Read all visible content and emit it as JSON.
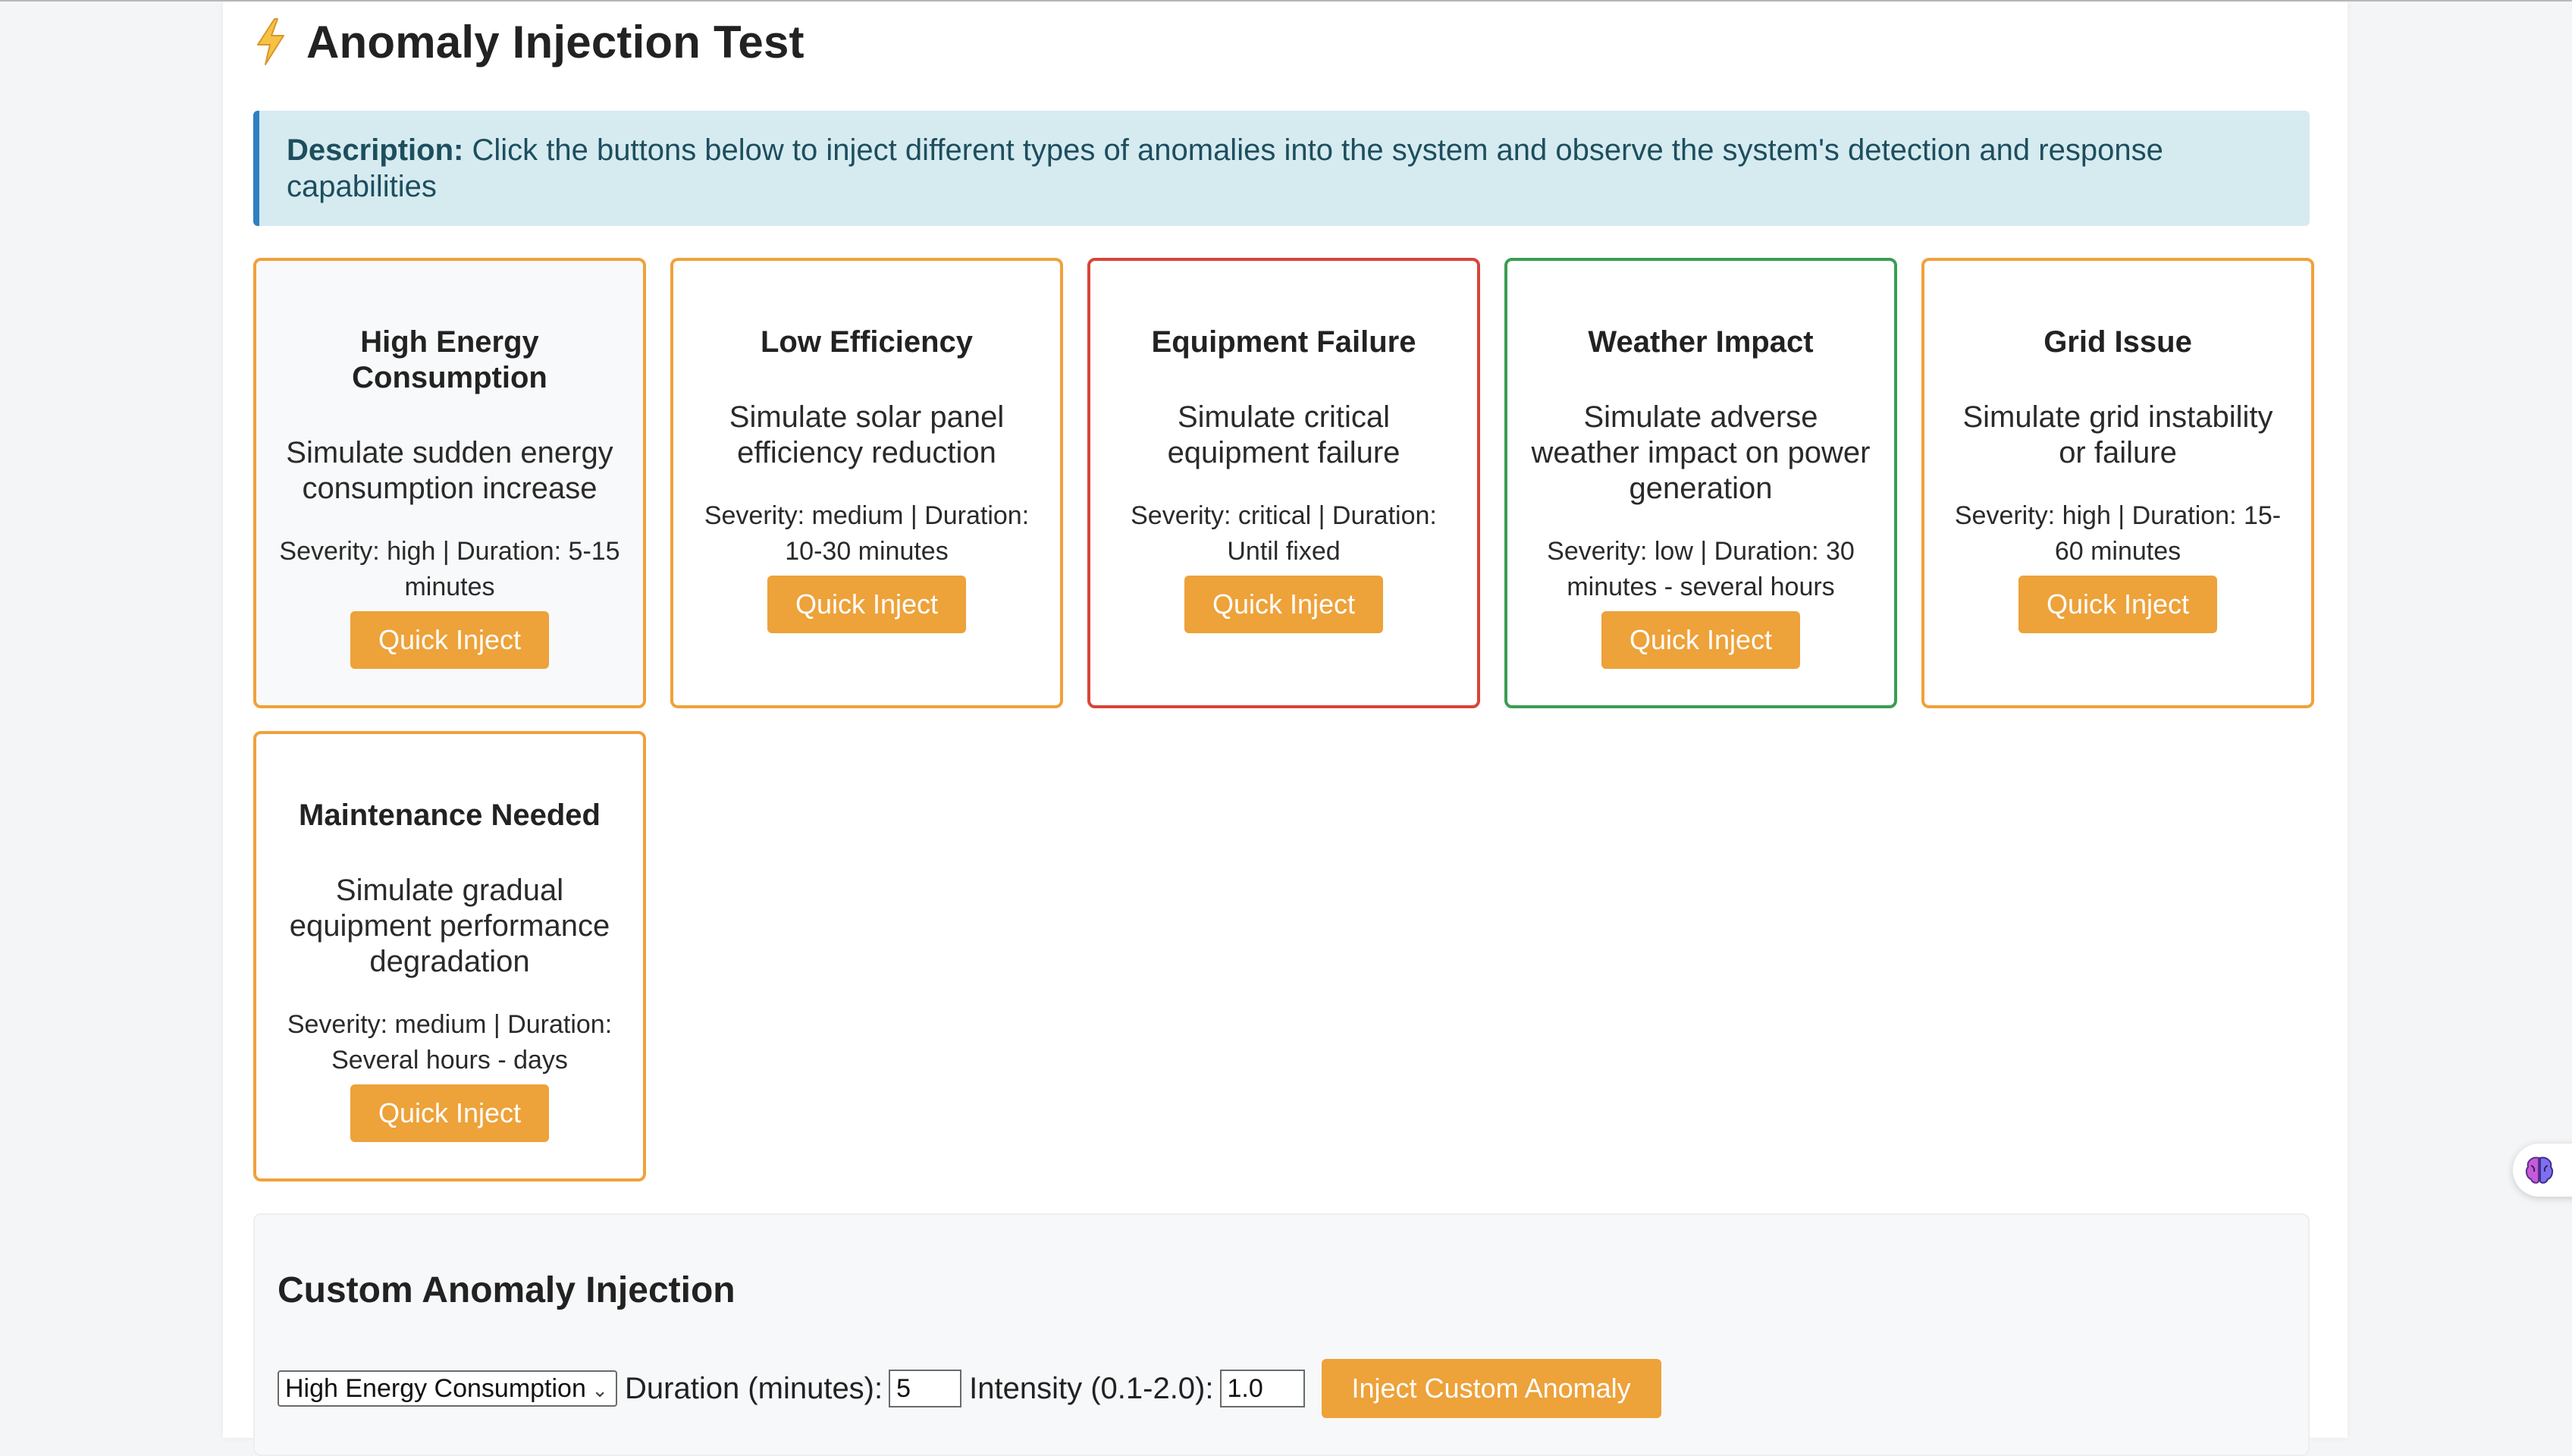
{
  "header": {
    "title": "Anomaly Injection Test",
    "icon": "lightning-bolt-icon"
  },
  "description": {
    "label": "Description:",
    "text": "Click the buttons below to inject different types of anomalies into the system and observe the system's detection and response capabilities"
  },
  "cards": [
    {
      "title": "High Energy Consumption",
      "description": "Simulate sudden energy consumption increase",
      "meta": "Severity: high | Duration: 5-15 minutes",
      "button": "Quick Inject",
      "border_color": "#f0a13a"
    },
    {
      "title": "Low Efficiency",
      "description": "Simulate solar panel efficiency reduction",
      "meta": "Severity: medium | Duration: 10-30 minutes",
      "button": "Quick Inject",
      "border_color": "#f0a13a"
    },
    {
      "title": "Equipment Failure",
      "description": "Simulate critical equipment failure",
      "meta": "Severity: critical | Duration: Until fixed",
      "button": "Quick Inject",
      "border_color": "#d9443a"
    },
    {
      "title": "Weather Impact",
      "description": "Simulate adverse weather impact on power generation",
      "meta": "Severity: low | Duration: 30 minutes - several hours",
      "button": "Quick Inject",
      "border_color": "#3a9e52"
    },
    {
      "title": "Grid Issue",
      "description": "Simulate grid instability or failure",
      "meta": "Severity: high | Duration: 15-60 minutes",
      "button": "Quick Inject",
      "border_color": "#f0a13a"
    },
    {
      "title": "Maintenance Needed",
      "description": "Simulate gradual equipment performance degradation",
      "meta": "Severity: medium | Duration: Several hours - days",
      "button": "Quick Inject",
      "border_color": "#f0a13a"
    }
  ],
  "custom": {
    "title": "Custom Anomaly Injection",
    "type_selected": "High Energy Consumption",
    "duration_label": "Duration (minutes):",
    "duration_value": "5",
    "intensity_label": "Intensity (0.1-2.0):",
    "intensity_value": "1.0",
    "button": "Inject Custom Anomaly"
  },
  "colors": {
    "accent": "#eda23a",
    "info_bg": "#d6ebf0",
    "info_border": "#2e80c2"
  },
  "floating_widget": {
    "icon": "brain-icon"
  }
}
